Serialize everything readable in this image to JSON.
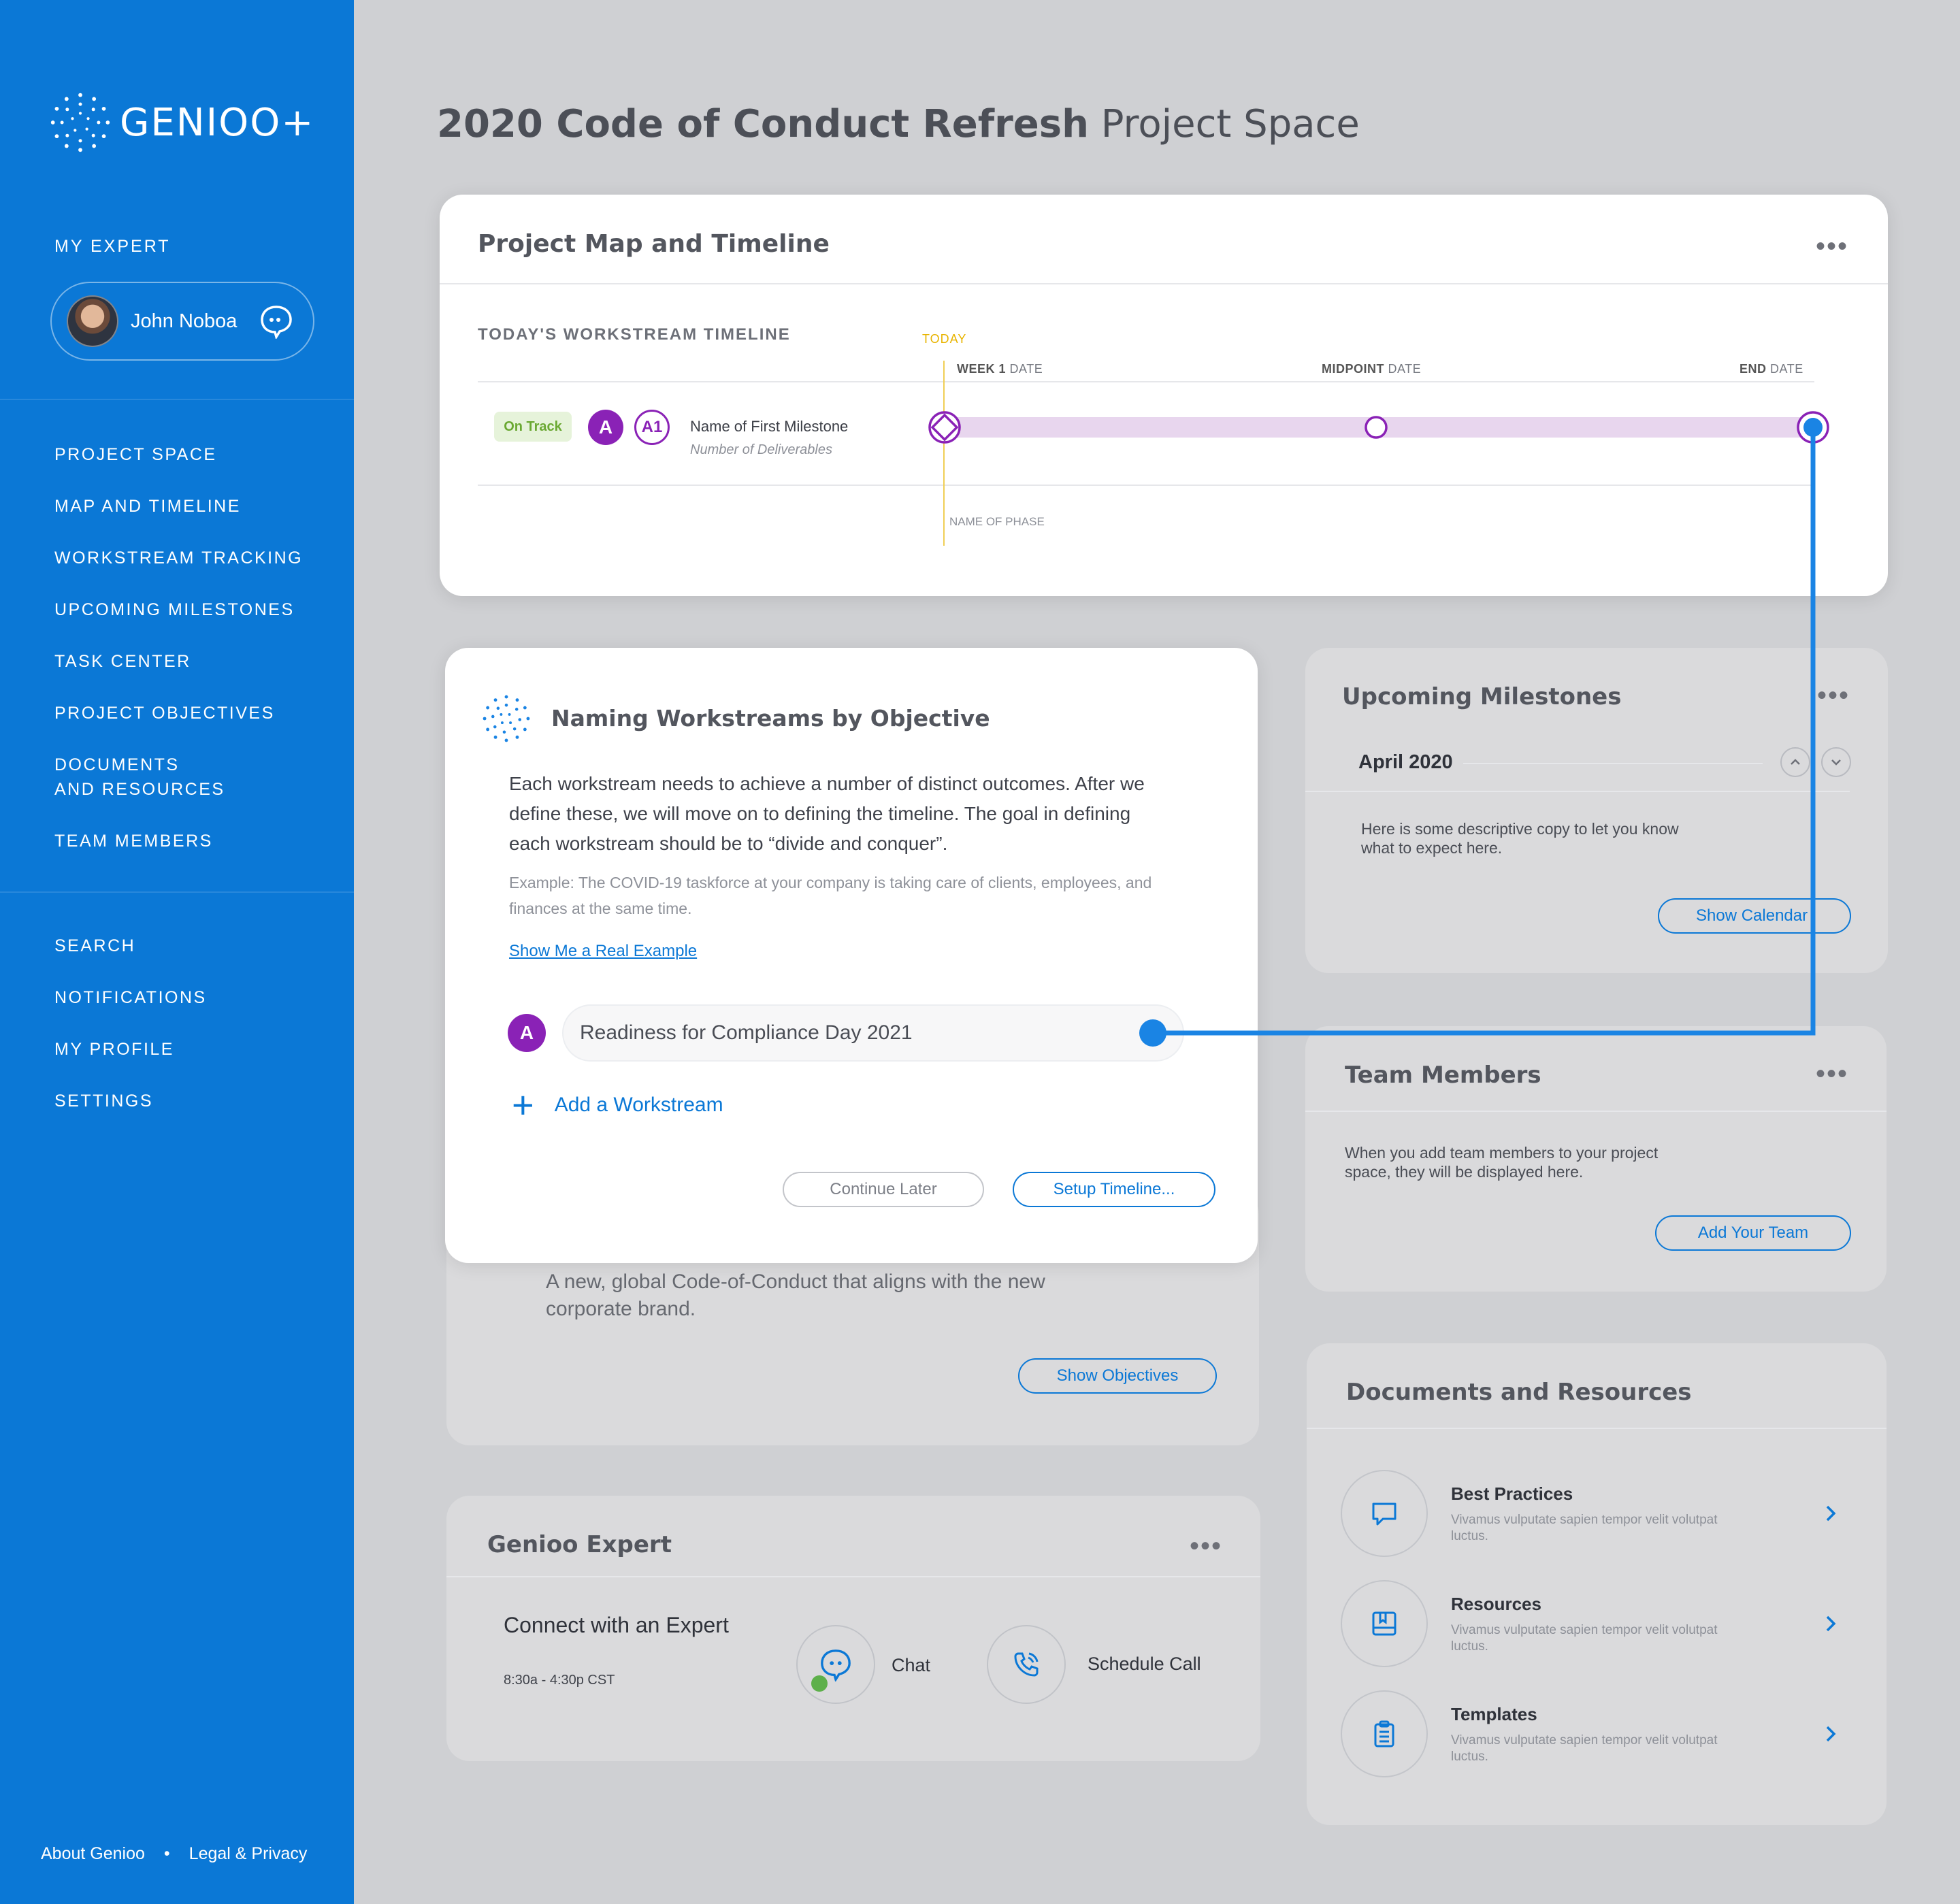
{
  "brand": {
    "name": "GENIOO+",
    "accent": "#0b78d6",
    "purple": "#8a22b6"
  },
  "sidebar": {
    "my_expert_label": "MY EXPERT",
    "expert_name": "John Noboa",
    "nav_primary": [
      "PROJECT SPACE",
      "MAP AND TIMELINE",
      "WORKSTREAM TRACKING",
      "UPCOMING MILESTONES",
      "TASK CENTER",
      "PROJECT OBJECTIVES",
      "DOCUMENTS",
      "AND RESOURCES",
      "TEAM MEMBERS"
    ],
    "nav_secondary": [
      "SEARCH",
      "NOTIFICATIONS",
      "MY PROFILE",
      "SETTINGS"
    ],
    "footer": {
      "about": "About Genioo",
      "sep": "•",
      "legal": "Legal & Privacy"
    }
  },
  "page": {
    "title_bold": "2020 Code of Conduct Refresh",
    "title_light": "Project Space"
  },
  "timeline_card": {
    "title": "Project Map and Timeline",
    "section_label": "TODAY'S WORKSTREAM TIMELINE",
    "today": "TODAY",
    "week1_bold": "WEEK 1",
    "week1_rest": "DATE",
    "mid_bold": "MIDPOINT",
    "mid_rest": "DATE",
    "end_bold": "END",
    "end_rest": "DATE",
    "status": "On Track",
    "badge_a": "A",
    "badge_a1": "A1",
    "milestone_name": "Name of First Milestone",
    "milestone_sub": "Number of Deliverables",
    "phase": "NAME OF PHASE"
  },
  "naming_card": {
    "title": "Naming Workstreams by Objective",
    "body": "Each workstream needs to achieve a number of distinct outcomes. After we define these, we will move on to defining the timeline. The goal in defining each workstream should be to “divide and conquer”.",
    "example": "Example: The COVID-19 taskforce at your company is taking care of clients, employees, and finances at the same time.",
    "link": "Show Me a Real Example",
    "workstream_badge": "A",
    "workstream_value": "Readiness for Compliance Day 2021",
    "add_label": "Add a Workstream",
    "continue_label": "Continue Later",
    "setup_label": "Setup Timeline..."
  },
  "objectives_card": {
    "text": "A new, global Code-of-Conduct that aligns with the new corporate brand.",
    "button": "Show Objectives"
  },
  "expert_card": {
    "title": "Genioo Expert",
    "connect": "Connect with an Expert",
    "hours": "8:30a - 4:30p CST",
    "chat": "Chat",
    "call": "Schedule Call",
    "online_color": "#5db04a"
  },
  "milestones_card": {
    "title": "Upcoming Milestones",
    "month": "April 2020",
    "desc": "Here is some descriptive copy to let you know what to expect here.",
    "button": "Show Calendar"
  },
  "team_card": {
    "title": "Team Members",
    "desc": "When you add team members to your project space, they will be displayed here.",
    "button": "Add Your Team"
  },
  "docs_card": {
    "title": "Documents and Resources",
    "items": [
      {
        "title": "Best Practices",
        "sub": "Vivamus vulputate sapien tempor velit volutpat luctus.",
        "icon": "chat-bubble-icon"
      },
      {
        "title": "Resources",
        "sub": "Vivamus vulputate sapien tempor velit volutpat luctus.",
        "icon": "book-icon"
      },
      {
        "title": "Templates",
        "sub": "Vivamus vulputate sapien tempor velit volutpat luctus.",
        "icon": "clipboard-icon"
      }
    ]
  }
}
